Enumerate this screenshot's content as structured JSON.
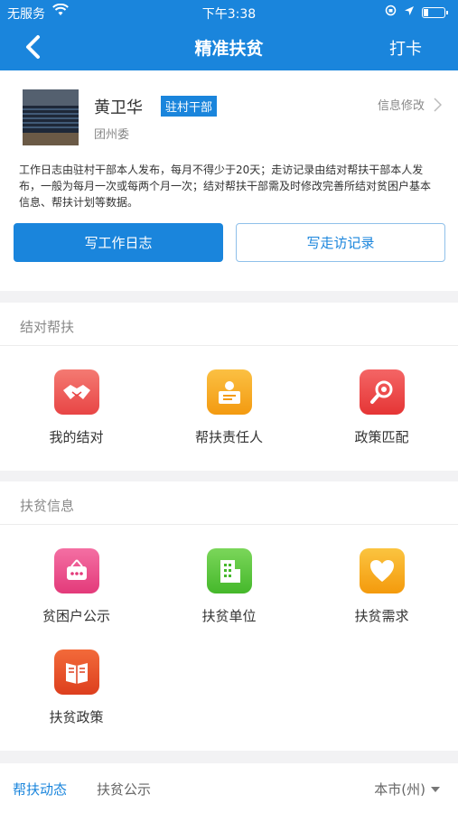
{
  "status_bar": {
    "carrier": "无服务",
    "time": "下午3:38"
  },
  "nav": {
    "title": "精准扶贫",
    "right_action": "打卡"
  },
  "profile": {
    "name": "黄卫华",
    "role": "驻村干部",
    "org": "团州委",
    "edit_label": "信息修改",
    "description": "工作日志由驻村干部本人发布，每月不得少于20天；走访记录由结对帮扶干部本人发布，一般为每月一次或每两个月一次；结对帮扶干部需及时修改完善所结对贫困户基本信息、帮扶计划等数据。",
    "write_log_label": "写工作日志",
    "write_visit_label": "写走访记录"
  },
  "pairing_section": {
    "title": "结对帮扶",
    "items": [
      {
        "label": "我的结对",
        "icon": "handshake-icon",
        "color": "#ef5b5b"
      },
      {
        "label": "帮扶责任人",
        "icon": "person-badge-icon",
        "color": "#f5a623"
      },
      {
        "label": "政策匹配",
        "icon": "search-icon",
        "color": "#f04a4a"
      }
    ]
  },
  "info_section": {
    "title": "扶贫信息",
    "items": [
      {
        "label": "贫困户公示",
        "icon": "signboard-icon",
        "color": "#ec4f8a"
      },
      {
        "label": "扶贫单位",
        "icon": "building-icon",
        "color": "#5cc63f"
      },
      {
        "label": "扶贫需求",
        "icon": "heart-icon",
        "color": "#f7a81b"
      },
      {
        "label": "扶贫政策",
        "icon": "book-icon",
        "color": "#ec5a2c"
      }
    ]
  },
  "bottom_tabs": {
    "active": "帮扶动态",
    "second": "扶贫公示",
    "region": "本市(州)"
  },
  "colors": {
    "primary": "#1a85dc",
    "background": "#f2f2f4"
  }
}
